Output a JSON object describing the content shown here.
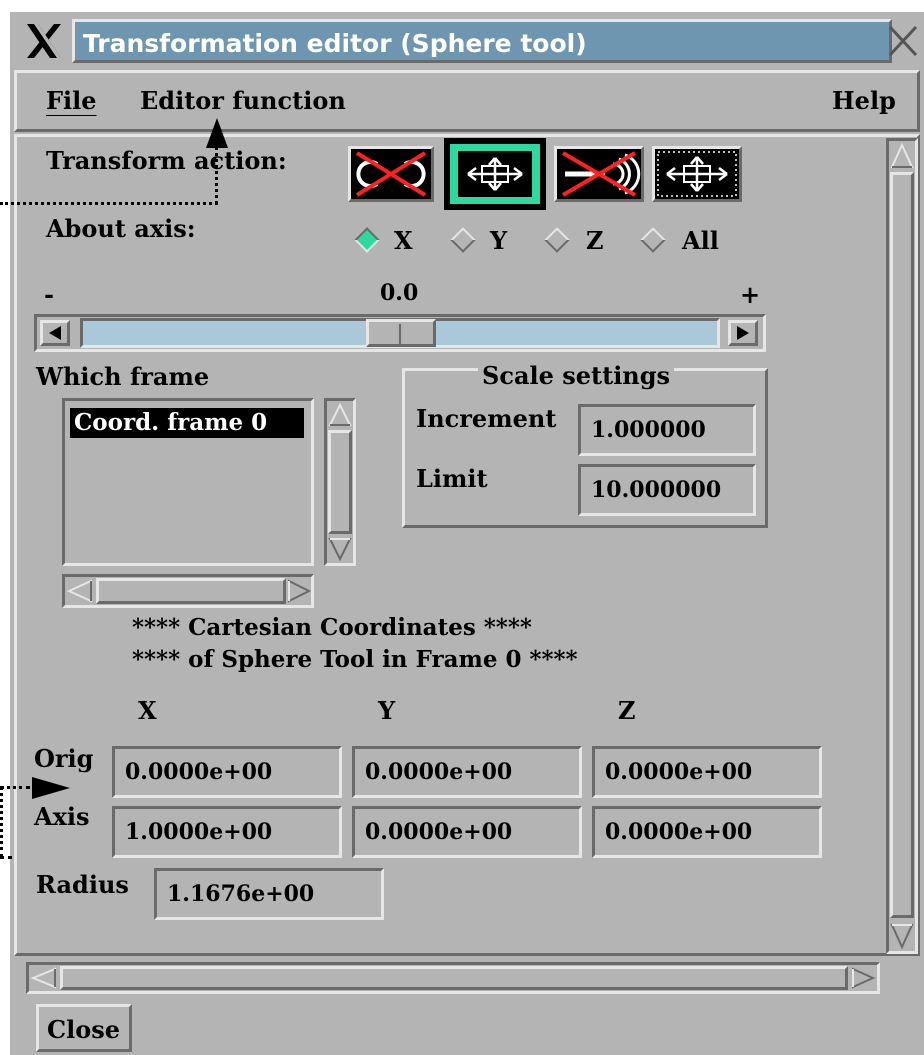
{
  "window": {
    "title": "Transformation editor (Sphere tool)"
  },
  "menubar": {
    "file": "File",
    "editor_function": "Editor function",
    "help": "Help"
  },
  "transform": {
    "label": "Transform action:"
  },
  "axis": {
    "label": "About axis:",
    "options": [
      "X",
      "Y",
      "Z",
      "All"
    ],
    "selected": "X"
  },
  "slider": {
    "minus": "-",
    "plus": "+",
    "value": "0.0"
  },
  "frame": {
    "label": "Which frame",
    "items": [
      "Coord. frame 0"
    ]
  },
  "scale": {
    "title": "Scale settings",
    "increment_label": "Increment",
    "increment_value": "1.000000",
    "limit_label": "Limit",
    "limit_value": "10.000000"
  },
  "coords": {
    "heading1": "**** Cartesian Coordinates ****",
    "heading2": "**** of Sphere Tool in Frame 0 ****",
    "col_x": "X",
    "col_y": "Y",
    "col_z": "Z",
    "orig_label": "Orig",
    "axis_label": "Axis",
    "radius_label": "Radius",
    "orig": [
      "0.0000e+00",
      "0.0000e+00",
      "0.0000e+00"
    ],
    "axis": [
      "1.0000e+00",
      "0.0000e+00",
      "0.0000e+00"
    ],
    "radius": "1.1676e+00"
  },
  "footer": {
    "close": "Close"
  },
  "colors": {
    "titlebar": "#6f96b0",
    "panel": "#b4b4b4",
    "slider_track": "#a9c8d8",
    "accent_green": "#2fd8a0",
    "selection_bg": "#000000"
  }
}
